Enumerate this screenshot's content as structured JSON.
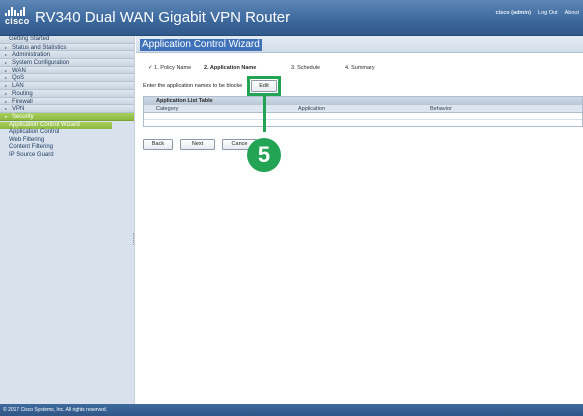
{
  "header": {
    "logo_text": "cisco",
    "title": "RV340 Dual WAN Gigabit VPN Router",
    "user": "cisco (admin)",
    "logout": "Log Out",
    "about": "About"
  },
  "sidebar": {
    "items": [
      {
        "label": "Getting Started",
        "arrow": ""
      },
      {
        "label": "Status and Statistics",
        "arrow": "▸"
      },
      {
        "label": "Administration",
        "arrow": "▸"
      },
      {
        "label": "System Configuration",
        "arrow": "▸"
      },
      {
        "label": "WAN",
        "arrow": "▸"
      },
      {
        "label": "QoS",
        "arrow": "▸"
      },
      {
        "label": "LAN",
        "arrow": "▸"
      },
      {
        "label": "Routing",
        "arrow": "▸"
      },
      {
        "label": "Firewall",
        "arrow": "▸"
      },
      {
        "label": "VPN",
        "arrow": "▸"
      },
      {
        "label": "Security",
        "arrow": "▾"
      }
    ],
    "security_subitems": [
      "Application Control Wizard",
      "Application Control",
      "Web Filtering",
      "Content Filtering",
      "IP Source Guard"
    ]
  },
  "main": {
    "page_title": "Application Control Wizard",
    "steps": [
      "✓ 1. Policy Name",
      "2. Application Name",
      "3. Schedule",
      "4. Summary"
    ],
    "instruction": "Enter the application names to be blocke",
    "edit_label": "Edit",
    "table": {
      "title": "Application List Table",
      "columns": [
        "Category",
        "Application",
        "Behavior"
      ]
    },
    "buttons": {
      "back": "Back",
      "next": "Next",
      "cancel": "Cance"
    },
    "callout_number": "5"
  },
  "footer": {
    "copyright": "© 2017 Cisco Systems, Inc. All rights reserved."
  },
  "colors": {
    "header_blue": "#3e6a9e",
    "active_green": "#8db943",
    "callout_green": "#23a455",
    "title_highlight": "#3f72b8"
  }
}
